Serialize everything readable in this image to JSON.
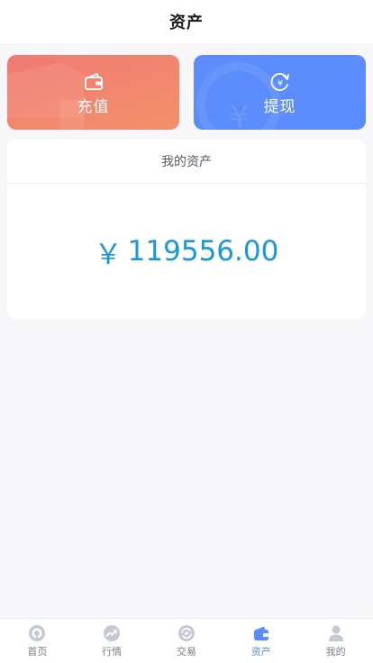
{
  "header": {
    "title": "资产"
  },
  "actions": {
    "recharge": {
      "label": "充值",
      "icon": "wallet-icon"
    },
    "withdraw": {
      "label": "提现",
      "icon": "yen-refresh-icon"
    }
  },
  "assets": {
    "title": "我的资产",
    "currency": "￥",
    "amount": "119556.00"
  },
  "tabbar": {
    "items": [
      {
        "label": "首页",
        "icon": "home-icon",
        "active": false
      },
      {
        "label": "行情",
        "icon": "trend-icon",
        "active": false
      },
      {
        "label": "交易",
        "icon": "exchange-icon",
        "active": false
      },
      {
        "label": "资产",
        "icon": "wallet-icon",
        "active": true
      },
      {
        "label": "我的",
        "icon": "user-icon",
        "active": false
      }
    ]
  },
  "colors": {
    "recharge_gradient_start": "#f07a74",
    "recharge_gradient_end": "#f3906a",
    "withdraw": "#5b8cff",
    "amount": "#1a98d5",
    "active_tab": "#5b8cff",
    "inactive_icon": "#c4c9d3"
  }
}
